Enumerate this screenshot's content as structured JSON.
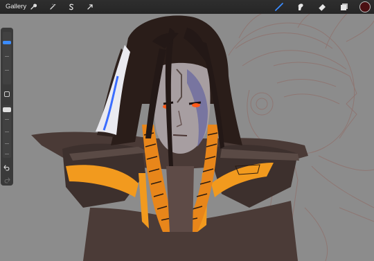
{
  "app": {
    "gallery_label": "Gallery"
  },
  "toolbar_left": {
    "icons": [
      "wrench-icon",
      "magic-wand-icon",
      "selection-s-icon",
      "transform-arrow-icon"
    ]
  },
  "toolbar_right": {
    "icons": [
      "brush-icon",
      "smudge-icon",
      "eraser-icon",
      "layers-icon"
    ],
    "active_tool": "brush-icon",
    "current_color": "#4a0f12"
  },
  "sidebar": {
    "brush_size_level": 0.9,
    "opacity_level": 1.0,
    "icons": [
      "modify-square-icon",
      "undo-icon",
      "redo-icon"
    ]
  },
  "colors": {
    "canvas": "#8c8c8c",
    "accent_blue": "#3b8cff",
    "toolbar": "#2a2a2a"
  }
}
